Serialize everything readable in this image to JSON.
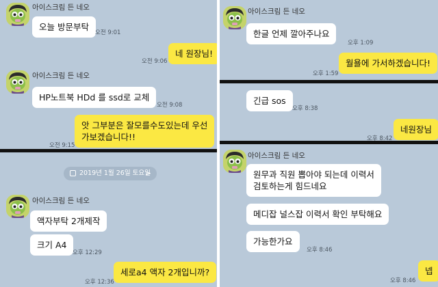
{
  "sender_name": "아이스크림 든 네오",
  "left_top": {
    "messages": [
      {
        "text": "오늘 방문부탁",
        "time": "오전 9:01"
      },
      {
        "text": "네 원장님!",
        "time": "오전 9:06"
      },
      {
        "text": "HP노트북 HDd 를 ssd로 교체",
        "time": "오전 9:08"
      },
      {
        "line1": "앗 그부분은 잘모를수도있는데 우선",
        "line2": "가보겠습니다!!",
        "time": "오전 9:15"
      }
    ]
  },
  "left_bottom": {
    "date_label": "2019년 1월 26일 토요일",
    "date_chevron": ">",
    "messages": [
      {
        "text": "액자부탁 2개제작"
      },
      {
        "text": "크기 A4",
        "time": "오후 12:29"
      },
      {
        "text": "세로a4 액자 2개입니까?",
        "time": "오후 12:36"
      }
    ]
  },
  "right_top": {
    "messages": [
      {
        "text": "한글 언제 깔아주나요",
        "time": "오후 1:09"
      },
      {
        "text": "월욜에 가서하겠습니다!",
        "time": "오후 1:59"
      }
    ]
  },
  "right_mid": {
    "messages": [
      {
        "text": "긴급 sos",
        "time": "오후 8:38"
      },
      {
        "text": "네원장님",
        "time": "오후 8:42"
      }
    ]
  },
  "right_bottom": {
    "messages": [
      {
        "line1": "원무과 직원 뽑아야 되는데 이력서",
        "line2": "검토하는게  힘드네요"
      },
      {
        "text": "메디잡 널스잡  이력서 확인 부탁해요"
      },
      {
        "text": "가능한가요",
        "time": "오후 8:46"
      },
      {
        "text": "넵",
        "time": "오후 8:46"
      }
    ]
  },
  "colors": {
    "chat_background": "#b9c9d9",
    "incoming_bubble": "#ffffff",
    "outgoing_bubble": "#fbe843",
    "divider": "#111111"
  },
  "icons": {
    "avatar": "neo-character-avatar",
    "calendar": "calendar-icon"
  }
}
